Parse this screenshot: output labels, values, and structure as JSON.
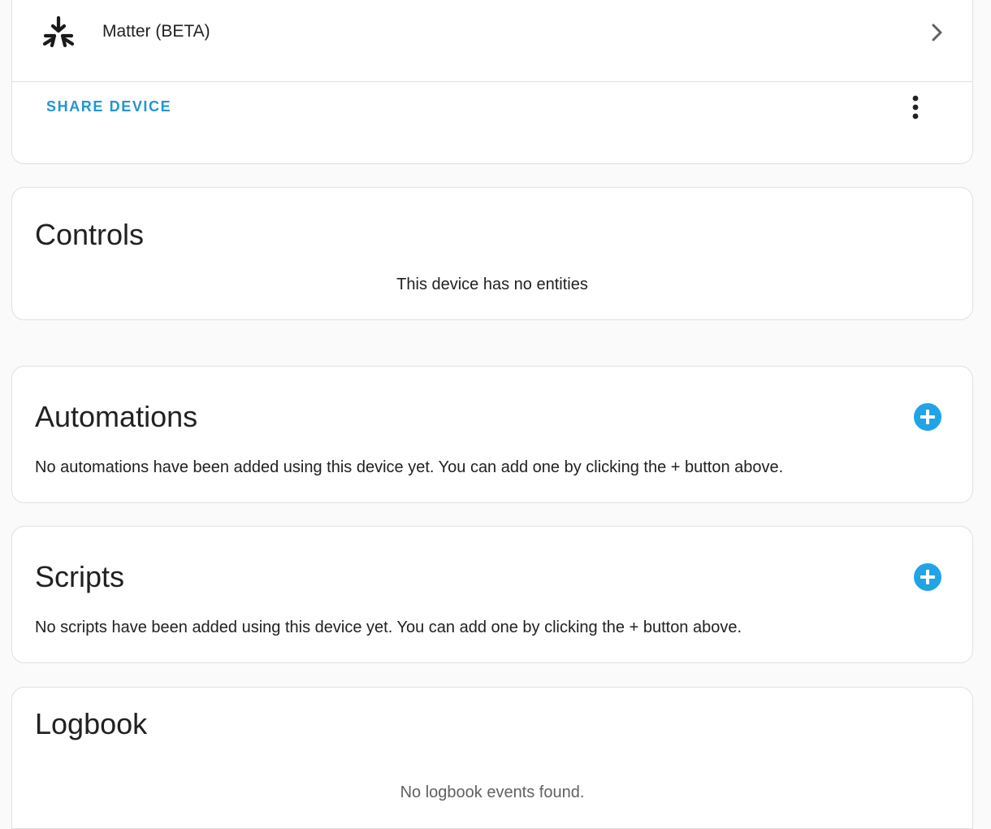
{
  "integration": {
    "name": "Matter (BETA)",
    "share_label": "SHARE DEVICE"
  },
  "controls": {
    "title": "Controls",
    "empty_text": "This device has no entities"
  },
  "automations": {
    "title": "Automations",
    "empty_text": "No automations have been added using this device yet. You can add one by clicking the + button above."
  },
  "scripts": {
    "title": "Scripts",
    "empty_text": "No scripts have been added using this device yet. You can add one by clicking the + button above."
  },
  "logbook": {
    "title": "Logbook",
    "empty_text": "No logbook events found."
  },
  "colors": {
    "accent": "#21a4e6",
    "share_text": "#2196d3",
    "card_border": "#e0e0e0",
    "page_bg": "#fafafa"
  },
  "icons": {
    "integration": "matter-logo-icon",
    "row_action": "chevron-right-icon",
    "menu": "dots-vertical-icon",
    "add": "plus-circle-icon"
  }
}
